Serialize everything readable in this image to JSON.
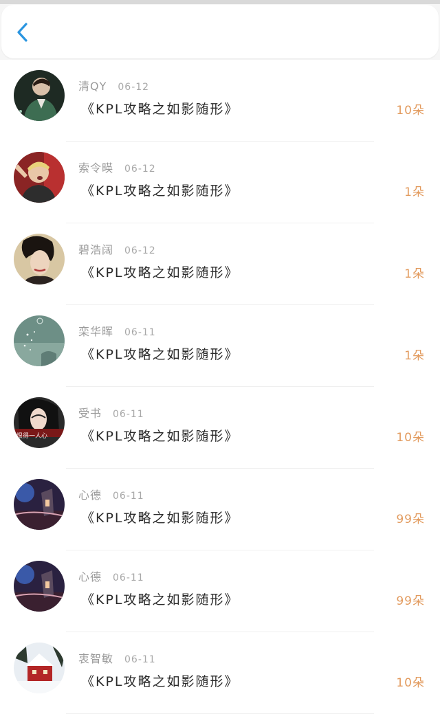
{
  "header": {
    "back_icon": "chevron-left-icon",
    "accent_color": "#2a95e0"
  },
  "rows": [
    {
      "name": "清QY",
      "date": "06-12",
      "title": "《KPL攻略之如影随形》",
      "count": "10朵"
    },
    {
      "name": "索令暎",
      "date": "06-12",
      "title": "《KPL攻略之如影随形》",
      "count": "1朵"
    },
    {
      "name": "碧浩阔",
      "date": "06-12",
      "title": "《KPL攻略之如影随形》",
      "count": "1朵"
    },
    {
      "name": "栾华晖",
      "date": "06-11",
      "title": "《KPL攻略之如影随形》",
      "count": "1朵"
    },
    {
      "name": "受书",
      "date": "06-11",
      "title": "《KPL攻略之如影随形》",
      "count": "10朵"
    },
    {
      "name": "心德",
      "date": "06-11",
      "title": "《KPL攻略之如影随形》",
      "count": "99朵"
    },
    {
      "name": "心德",
      "date": "06-11",
      "title": "《KPL攻略之如影随形》",
      "count": "99朵"
    },
    {
      "name": "衷智敏",
      "date": "06-11",
      "title": "《KPL攻略之如影随形》",
      "count": "10朵"
    }
  ],
  "avatar_watermark": "恨得一人心",
  "colors": {
    "count": "#e29a5d",
    "name": "#9a9a9a",
    "title": "#2b2b2b"
  }
}
